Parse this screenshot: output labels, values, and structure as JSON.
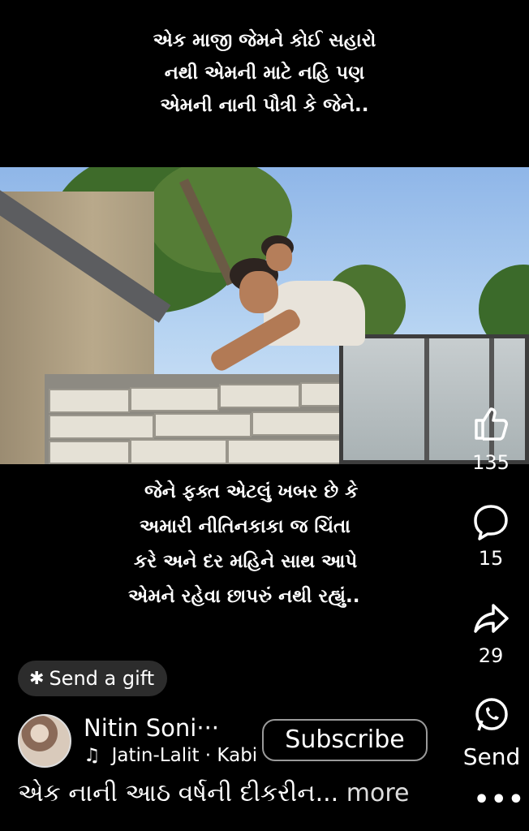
{
  "overlay_top": {
    "lines": [
      "એક માજી જેમને કોઈ સહારો",
      "નથી એમની માટે નહિ પણ",
      "એમની નાની પૌત્રી કે જેને.."
    ]
  },
  "overlay_bottom": {
    "lines": [
      "જેને ફક્ત એટલું ખબર છે કે",
      "અમારી નીતિનકાકા જ ચિંતા",
      "કરે અને દર મહિને સાથ આપે",
      "એમને રહેવા છાપરું નથી રહ્યું.."
    ]
  },
  "actions": {
    "like_count": "135",
    "comment_count": "15",
    "share_count": "29",
    "send_label": "Send"
  },
  "gift": {
    "label": "Send a gift"
  },
  "channel": {
    "name": "Nitin Soni···",
    "subscribe_label": "Subscribe"
  },
  "music": {
    "text": "Jatin-Lalit · Kabi"
  },
  "description": {
    "text": "એક નાની આઠ વર્ષની દીકરીન...",
    "more_label": "more",
    "menu_label": "•••"
  },
  "colors": {
    "background": "#000000",
    "pill": "#2c2c2c",
    "text": "#ffffff"
  }
}
